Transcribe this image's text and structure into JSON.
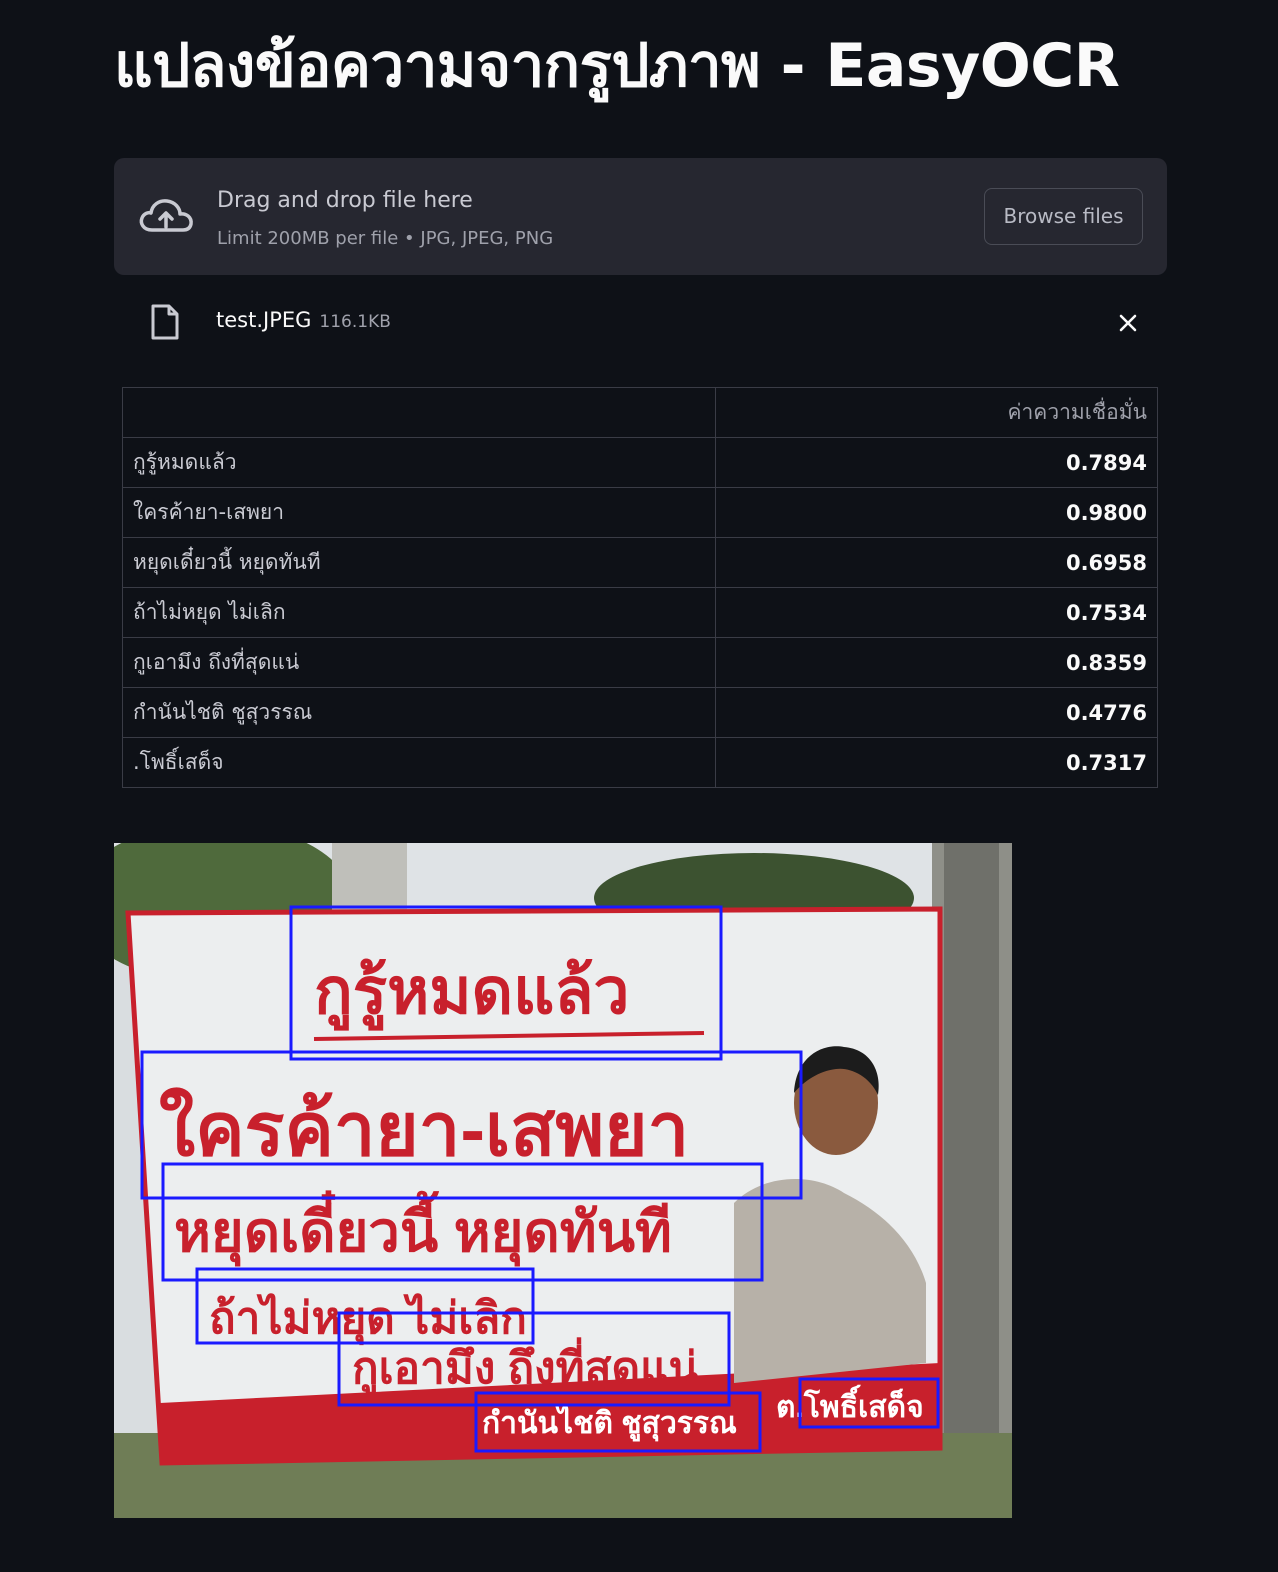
{
  "page": {
    "title": "แปลงข้อความจากรูปภาพ - EasyOCR"
  },
  "uploader": {
    "drop_label": "Drag and drop file here",
    "limit_label": "Limit 200MB per file • JPG, JPEG, PNG",
    "browse_label": "Browse files",
    "icon": "cloud-upload-icon"
  },
  "uploaded_file": {
    "name": "test.JPEG",
    "size": "116.1KB",
    "icon": "file-icon",
    "remove_icon": "close-icon"
  },
  "results_table": {
    "columns": [
      "",
      "ค่าความเชื่อมั่น"
    ],
    "rows": [
      {
        "text": "กูรู้หมดแล้ว",
        "confidence": "0.7894"
      },
      {
        "text": "ใครค้ายา-เสพยา",
        "confidence": "0.9800"
      },
      {
        "text": "หยุดเดี๋ยวนี้ หยุดทันที",
        "confidence": "0.6958"
      },
      {
        "text": "ถ้าไม่หยุด ไม่เลิก",
        "confidence": "0.7534"
      },
      {
        "text": "กูเอามึง ถึงที่สุดแน่",
        "confidence": "0.8359"
      },
      {
        "text": "กำนันไชติ ชูสุวรรณ",
        "confidence": "0.4776"
      },
      {
        "text": ".โพธิ์เสด็จ",
        "confidence": "0.7317"
      }
    ]
  },
  "image": {
    "banner_lines": [
      "กูรู้หมดแล้ว",
      "ใครค้ายา-เสพยา",
      "หยุดเดี๋ยวนี้ หยุดทันที",
      "ถ้าไม่หยุด ไม่เลิก",
      "กูเอามึง ถึงที่สุดแน่",
      "กำนันไชติ ชูสุวรรณ",
      "ต.โพธิ์เสด็จ"
    ],
    "colors": {
      "banner_text": "#c8202c",
      "box": "#1a1aff",
      "banner_bg": "#eceeef"
    }
  },
  "theme": {
    "background": "#0e1117",
    "panel": "#262730",
    "text": "#fafafa",
    "muted": "#9fa1ab"
  }
}
